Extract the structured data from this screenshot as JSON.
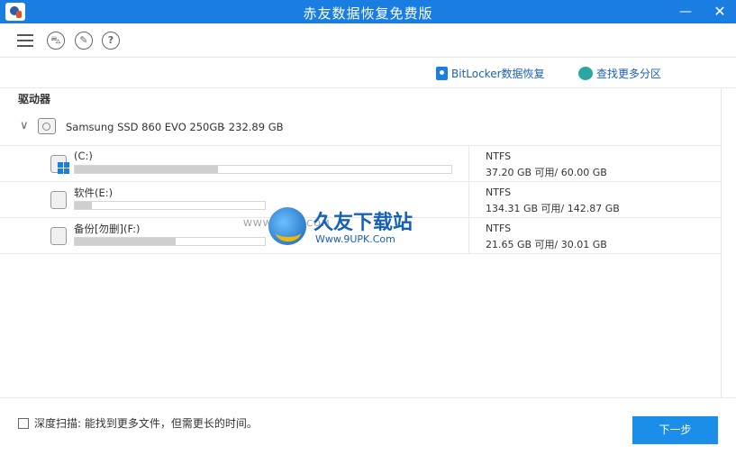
{
  "window": {
    "title": "赤友数据恢复免费版",
    "minimize": "—",
    "close": "✕"
  },
  "toolbar": {
    "icons": [
      "menu-icon",
      "cart-icon",
      "wrench-icon",
      "help-icon"
    ],
    "help_glyph": "?"
  },
  "actions": {
    "bitlocker": "BitLocker数据恢复",
    "find_partitions": "查找更多分区"
  },
  "section": {
    "drives_label": "驱动器"
  },
  "disk": {
    "name": "Samsung SSD 860 EVO 250GB",
    "size": "- 232.89 GB"
  },
  "partitions": [
    {
      "name": "(C:)",
      "fs": "NTFS",
      "space": "37.20 GB 可用/ 60.00 GB",
      "used_fraction": 0.38,
      "bar_width": 420,
      "system": true
    },
    {
      "name": "软件(E:)",
      "fs": "NTFS",
      "space": "134.31 GB 可用/ 142.87 GB",
      "used_fraction": 0.09,
      "bar_width": 213,
      "system": false
    },
    {
      "name": "备份[勿删](F:)",
      "fs": "NTFS",
      "space": "21.65 GB 可用/ 30.01 GB",
      "used_fraction": 0.53,
      "bar_width": 213,
      "system": false
    }
  ],
  "footer": {
    "deep_scan_label": "深度扫描:",
    "deep_scan_desc": " 能找到更多文件，但需更长的时间。",
    "next_label": "下一步"
  },
  "watermark": {
    "url_left": "WWW.9UPK.COM",
    "name": "久友下载站",
    "url": "Www.9UPK.Com"
  },
  "colors": {
    "titlebar": "#1a7de1",
    "link": "#1a5fb4",
    "button": "#1a8ee8"
  }
}
